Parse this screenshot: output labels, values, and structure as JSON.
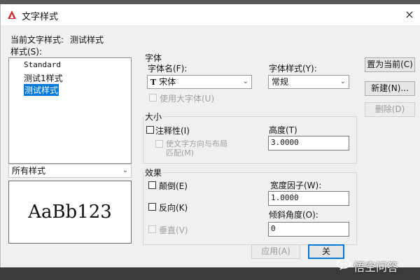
{
  "title_bar": {
    "title": "文字样式",
    "close": "×"
  },
  "current_style": {
    "label": "当前文字样式:",
    "value": "测试样式"
  },
  "styles": {
    "label": "样式(S):",
    "items": [
      "Standard",
      "测试1样式",
      "测试样式"
    ],
    "selected_index": 2
  },
  "filter": {
    "value": "所有样式"
  },
  "preview": {
    "text": "AaBb123"
  },
  "font": {
    "group": "字体",
    "name_label": "字体名(F):",
    "name_value": "宋体",
    "style_label": "字体样式(Y):",
    "style_value": "常规",
    "bigfont_label": "使用大字体(U)"
  },
  "size": {
    "group": "大小",
    "annotative_label": "注释性(I)",
    "match_label_line1": "使文字方向与布局",
    "match_label_line2": "匹配(M)",
    "height_label": "高度(T)",
    "height_value": "3.0000"
  },
  "effects": {
    "group": "效果",
    "upside_down": "颠倒(E)",
    "backwards": "反向(K)",
    "vertical": "垂直(V)",
    "width_factor_label": "宽度因子(W):",
    "width_factor_value": "1.0000",
    "oblique_label": "倾斜角度(O):",
    "oblique_value": "0"
  },
  "buttons": {
    "set_current": "置为当前(C)",
    "new": "新建(N)...",
    "delete": "删除(D)",
    "apply": "应用(A)",
    "close": "关"
  },
  "watermark": "悟空问答",
  "colors": {
    "selection": "#0078d7",
    "title_icon": "#d32f2f"
  },
  "icons": {
    "font_type": "truetype-icon",
    "app": "autocad-icon"
  }
}
